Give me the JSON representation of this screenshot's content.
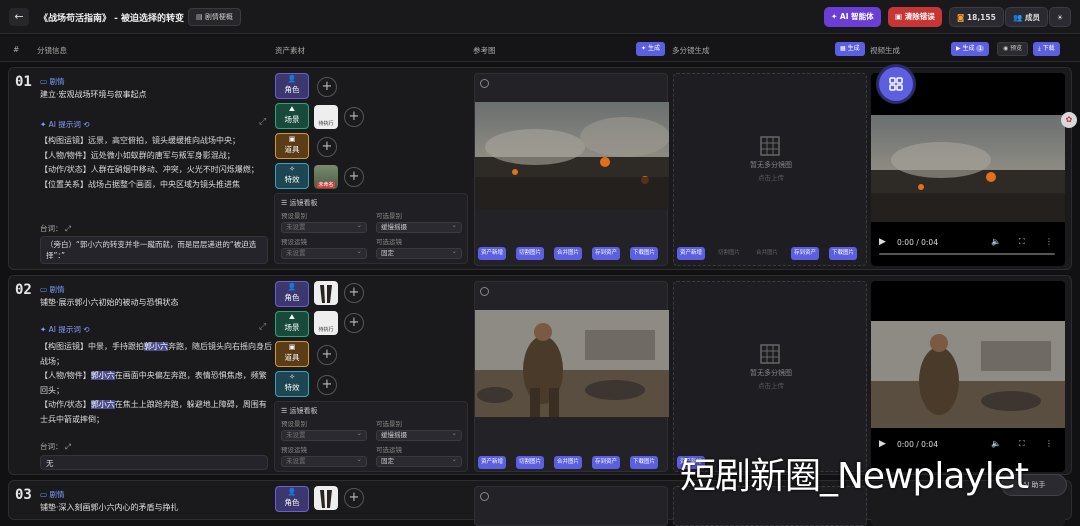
{
  "header": {
    "back_icon": "arrow-left-icon",
    "title": "《战场苟活指南》 - 被迫选择的转变",
    "script_btn": "剧情梗概",
    "ai_btn": "AI 智能体",
    "clear_btn": "清除错误",
    "credits": "18,155",
    "members_btn": "成员",
    "colors": {
      "ai": "#6b3fd6",
      "clear": "#d63a3a",
      "accent": "#5b5fe0"
    }
  },
  "columns": {
    "index": "#",
    "shot": "分镜信息",
    "assets": "资产素材",
    "ref": "参考图",
    "gen_label": "生成",
    "multi": "多分镜生成",
    "video": "视频生成",
    "gen_count": "1",
    "preview": "预览",
    "download": "下载"
  },
  "labels": {
    "plot": "剧情",
    "ai_prompt": "AI 提示词",
    "dialogue": "台词：",
    "role": "角色",
    "scene": "场景",
    "prop": "道具",
    "fx": "特效",
    "cam_panel": "运镜看板",
    "preset_shot": "预设景别",
    "opt_shot": "可选景别",
    "preset_move": "预设运镜",
    "opt_move": "可选运镜",
    "unset": "未设置",
    "multi_empty": "暂无多分镜图",
    "multi_hint": "点击上传",
    "scene_thumb": "待执行",
    "fx_thumb": "未命名"
  },
  "actions": {
    "asset_add": "资产新增",
    "cut_img": "切割图片",
    "merge_img": "合并图片",
    "save_asset": "存到资产",
    "download_img": "下载图片"
  },
  "rows": [
    {
      "num": "01",
      "subtitle": "建立·宏观战场环境与叙事起点",
      "desc": [
        [
          {
            "t": "【构图运镜】远景，高空俯拍，镜头缓缓推向战场中央；"
          }
        ],
        [
          {
            "t": "【人物/物件】远处微小如蚁群的唐军与叛军身影混战；"
          }
        ],
        [
          {
            "t": "【动作/状态】人群在硝烟中移动、冲突，火光不时闪烁爆燃；"
          }
        ],
        [
          {
            "t": "【位置关系】战场占据整个画面，中央区域为镜头推进焦"
          }
        ]
      ],
      "dialogue": "（旁白）“郭小六的转变并非一蹴而就，而是层层递进的“被迫选择”：”",
      "opt_shot": "缓慢摇摄",
      "opt_move": "固定",
      "video_time": "0:00 / 0:04"
    },
    {
      "num": "02",
      "subtitle": "铺垫·展示郭小六初始的被动与恐惧状态",
      "desc": [
        [
          {
            "t": "【构图运镜】中景，手持跟拍"
          },
          {
            "t": "郭小六",
            "h": true
          },
          {
            "t": "奔跑，随后镜头向右摇向身后战场；"
          }
        ],
        [
          {
            "t": "【人物/物件】"
          },
          {
            "t": "郭小六",
            "h": true
          },
          {
            "t": "在画面中央偏左奔跑，表情恐惧焦虑，频繁回头；"
          }
        ],
        [
          {
            "t": "【动作/状态】"
          },
          {
            "t": "郭小六",
            "h": true
          },
          {
            "t": "在焦土上踉跄奔跑，躲避地上障碍，周围有士兵中箭或摔倒；"
          }
        ]
      ],
      "dialogue": "无",
      "opt_shot": "缓慢摇摄",
      "opt_move": "固定",
      "video_time": "0:00 / 0:04"
    },
    {
      "num": "03",
      "subtitle": "铺垫·深入刻画郭小六内心的矛盾与挣扎"
    }
  ],
  "watermark": "短剧新圈_Newplaylet",
  "float_btn": "AI 助手"
}
